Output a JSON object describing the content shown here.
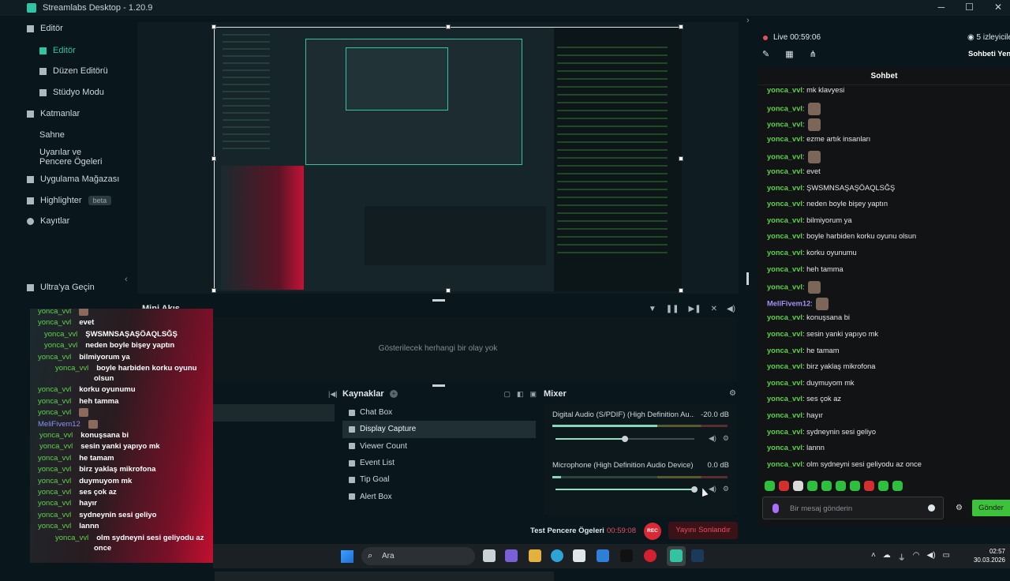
{
  "window": {
    "title": "Streamlabs Desktop - 1.20.9"
  },
  "sidebar": {
    "items": [
      {
        "label": "Editör"
      },
      {
        "label": "Editör"
      },
      {
        "label": "Düzen Editörü"
      },
      {
        "label": "Stüdyo Modu"
      },
      {
        "label": "Katmanlar"
      },
      {
        "label": "Sahne"
      },
      {
        "label": "Uyarılar ve Pencere Ögeleri"
      },
      {
        "label": "Uygulama Mağazası"
      },
      {
        "label": "Highlighter"
      },
      {
        "label": "Kayıtlar"
      },
      {
        "label": "Ultra'ya Geçin"
      }
    ],
    "beta": "beta"
  },
  "mini_feed": {
    "title": "Mini Akış",
    "empty": "Gösterilecek herhangi bir olay yok"
  },
  "sources": {
    "title": "Kaynaklar",
    "items": [
      "Chat Box",
      "Display Capture",
      "Viewer Count",
      "Event List",
      "Tip Goal",
      "Alert Box"
    ],
    "selected": 1
  },
  "mixer": {
    "title": "Mixer",
    "channels": [
      {
        "name": "Digital Audio (S/PDIF) (High Definition Au...",
        "db": "-20.0 dB",
        "level": 0.6,
        "volume": 0.5
      },
      {
        "name": "Microphone (High Definition Audio Device)",
        "db": "0.0 dB",
        "level": 0.05,
        "volume": 1.0
      }
    ]
  },
  "footer": {
    "label": "Test Pencere Ögeleri",
    "time": "00:59:08",
    "rec": "REC",
    "stop": "Yayını Sonlandır"
  },
  "overlay_chat": [
    {
      "user": "yonca_vvl",
      "text": "",
      "emote": true
    },
    {
      "user": "yonca_vvl",
      "text": "evet"
    },
    {
      "user": "yonca_vvl",
      "text": "ŞWSMNSAŞAŞÖAQLSĞŞ"
    },
    {
      "user": "yonca_vvl",
      "text": "neden boyle bişey yaptın"
    },
    {
      "user": "yonca_vvl",
      "text": "bilmiyorum ya"
    },
    {
      "user": "yonca_vvl",
      "text": "boyle harbiden korku oyunu",
      "text2": "olsun"
    },
    {
      "user": "yonca_vvl",
      "text": "korku oyunumu"
    },
    {
      "user": "yonca_vvl",
      "text": "heh tamma"
    },
    {
      "user": "yonca_vvl",
      "text": "",
      "emote": true
    },
    {
      "user": "MeliFivem12",
      "text": "",
      "emote": true,
      "purple": true
    },
    {
      "user": "yonca_vvl",
      "text": "konuşsana bi"
    },
    {
      "user": "yonca_vvl",
      "text": "sesin yanki yapıyo mk"
    },
    {
      "user": "yonca_vvl",
      "text": "he tamam"
    },
    {
      "user": "yonca_vvl",
      "text": "birz yaklaş mikrofona"
    },
    {
      "user": "yonca_vvl",
      "text": "duymuyom mk"
    },
    {
      "user": "yonca_vvl",
      "text": "ses çok az"
    },
    {
      "user": "yonca_vvl",
      "text": "hayır"
    },
    {
      "user": "yonca_vvl",
      "text": "sydneynin sesi geliyo"
    },
    {
      "user": "yonca_vvl",
      "text": "lannn"
    },
    {
      "user": "yonca_vvl",
      "text": "olm sydneyni sesi geliyodu az",
      "text2": "once"
    }
  ],
  "stream": {
    "live": "Live 00:59:06",
    "viewers": "5 izleyicile",
    "chat_new": "Sohbeti Yeni"
  },
  "chat": {
    "title": "Sohbet",
    "messages": [
      {
        "user": "yonca_vvl",
        "text": "mk klavyesi"
      },
      {
        "user": "yonca_vvl",
        "text": "",
        "emote": true
      },
      {
        "user": "yonca_vvl",
        "text": "",
        "emote": true
      },
      {
        "user": "yonca_vvl",
        "text": "ezme artık insanları"
      },
      {
        "user": "yonca_vvl",
        "text": "",
        "emote": true
      },
      {
        "user": "yonca_vvl",
        "text": "evet"
      },
      {
        "user": "yonca_vvl",
        "text": "ŞWSMNSAŞAŞÖAQLSĞŞ"
      },
      {
        "user": "yonca_vvl",
        "text": "neden boyle bişey yaptın"
      },
      {
        "user": "yonca_vvl",
        "text": "bilmiyorum ya"
      },
      {
        "user": "yonca_vvl",
        "text": "boyle harbiden korku oyunu olsun"
      },
      {
        "user": "yonca_vvl",
        "text": "korku oyunumu"
      },
      {
        "user": "yonca_vvl",
        "text": "heh tamma"
      },
      {
        "user": "yonca_vvl",
        "text": "",
        "emote": true
      },
      {
        "user": "MeliFivem12",
        "text": "",
        "emote": true,
        "purple": true
      },
      {
        "user": "yonca_vvl",
        "text": "konuşsana bi"
      },
      {
        "user": "yonca_vvl",
        "text": "sesin yanki yapıyo mk"
      },
      {
        "user": "yonca_vvl",
        "text": "he tamam"
      },
      {
        "user": "yonca_vvl",
        "text": "birz yaklaş mikrofona"
      },
      {
        "user": "yonca_vvl",
        "text": "duymuyom mk"
      },
      {
        "user": "yonca_vvl",
        "text": "ses çok az"
      },
      {
        "user": "yonca_vvl",
        "text": "hayır"
      },
      {
        "user": "yonca_vvl",
        "text": "sydneynin sesi geliyo"
      },
      {
        "user": "yonca_vvl",
        "text": "lannn"
      },
      {
        "user": "yonca_vvl",
        "text": "olm sydneyni sesi geliyodu az once"
      }
    ],
    "placeholder": "Bir mesaj gönderin",
    "send": "Gönder"
  },
  "taskbar": {
    "search": "Ara",
    "time": "02:57",
    "date": "30.03.2026"
  },
  "colors": {
    "accent": "#31c3a2",
    "live": "#e84f5b",
    "chat_user": "#5fd34a",
    "send": "#3ec23c"
  }
}
